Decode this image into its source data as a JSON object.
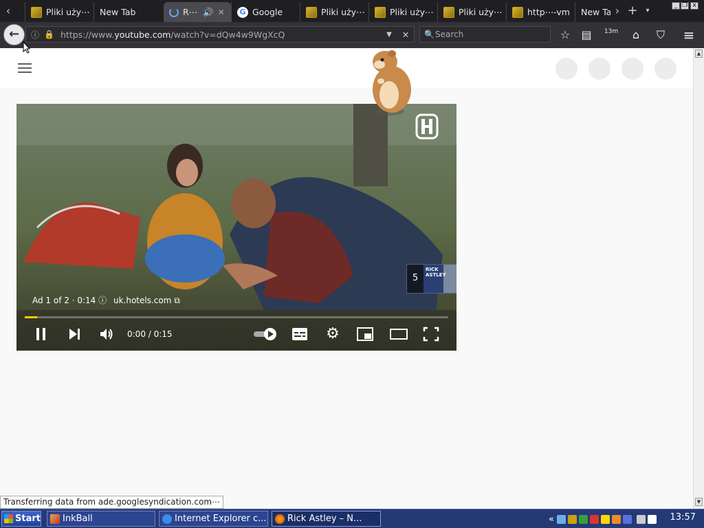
{
  "tabs": [
    {
      "label": "Pliki uży⋯",
      "icon": "yellow-favicon-icon"
    },
    {
      "label": "New Tab",
      "icon": "none"
    },
    {
      "label": "R⋯",
      "icon": "loading-spinner-icon",
      "active": true
    },
    {
      "label": "Google",
      "icon": "google-icon"
    },
    {
      "label": "Pliki uży⋯",
      "icon": "yellow-favicon-icon"
    },
    {
      "label": "Pliki uży⋯",
      "icon": "yellow-favicon-icon"
    },
    {
      "label": "Pliki uży⋯",
      "icon": "yellow-favicon-icon"
    },
    {
      "label": "http⋯-vm",
      "icon": "yellow-favicon-icon"
    },
    {
      "label": "New Ta",
      "icon": "none"
    }
  ],
  "toolbar": {
    "url_prefix": "https://www.",
    "url_domain": "youtube.com",
    "url_path": "/watch?v=dQw4w9WgXcQ",
    "search_placeholder": "Search",
    "back_glyph": "←",
    "more_tabs_glyph": "›",
    "new_tab_glyph": "+",
    "tabs_menu_glyph": "▾",
    "dropdown_glyph": "▼",
    "clear_glyph": "✕",
    "star_glyph": "☆",
    "home_glyph": "⌂",
    "menu_glyph": "≡",
    "timer_label": "13m"
  },
  "player": {
    "ad_text": "Ad 1 of 2 · 0:14",
    "ad_info_glyph": "ⓘ",
    "ad_site": "uk.hotels.com",
    "time_display": "0:00 / 0:15",
    "skip_countdown": "5",
    "thumb_label": "RICK ASTLEY",
    "progress": 0.03
  },
  "status": {
    "text": "Transferring data from ade.googlesyndication.com⋯"
  },
  "taskbar": {
    "start_label": "Start",
    "tasks": [
      {
        "label": "InkBall"
      },
      {
        "label": "Internet Explorer c..."
      },
      {
        "label": "Rick Astley – N..."
      }
    ],
    "tray_arrows": "«",
    "clock": "13:57"
  },
  "colors": {
    "accent": "#ffcc00",
    "taskbar": "#233a77",
    "browser": "#1f1f23"
  }
}
